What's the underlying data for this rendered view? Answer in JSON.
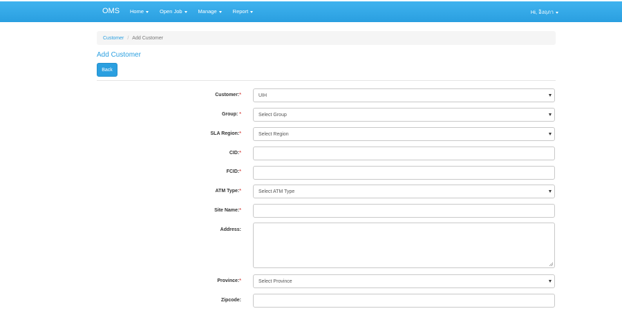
{
  "navbar": {
    "brand": "OMS",
    "items": [
      {
        "label": "Home"
      },
      {
        "label": "Open Job"
      },
      {
        "label": "Manage"
      },
      {
        "label": "Report"
      }
    ],
    "user": "Hi, อิงฤภา"
  },
  "breadcrumb": {
    "parent": "Customer",
    "separator": "/",
    "current": "Add Customer"
  },
  "page": {
    "title": "Add Customer",
    "back_label": "Back"
  },
  "form": {
    "required_mark": "*",
    "customer": {
      "label": "Customer:",
      "value": "UIH"
    },
    "group": {
      "label": "Group: ",
      "value": "Select Group"
    },
    "sla_region": {
      "label": "SLA Region:",
      "value": "Select Region"
    },
    "cid": {
      "label": "CID:",
      "value": ""
    },
    "fcid": {
      "label": "FCID:",
      "value": ""
    },
    "atm_type": {
      "label": "ATM Type:",
      "value": "Select ATM Type"
    },
    "site_name": {
      "label": "Site Name:",
      "value": ""
    },
    "address": {
      "label": "Address:",
      "value": ""
    },
    "province": {
      "label": "Province:",
      "value": "Select Province"
    },
    "zipcode": {
      "label": "Zipcode:",
      "value": ""
    }
  },
  "colors": {
    "navbar": "#2a9fe0",
    "accent": "#2a9fe0",
    "required": "#d9534f"
  },
  "icons": {
    "dropdown": "chevron-down-icon",
    "resize": "resize-grip-icon"
  }
}
